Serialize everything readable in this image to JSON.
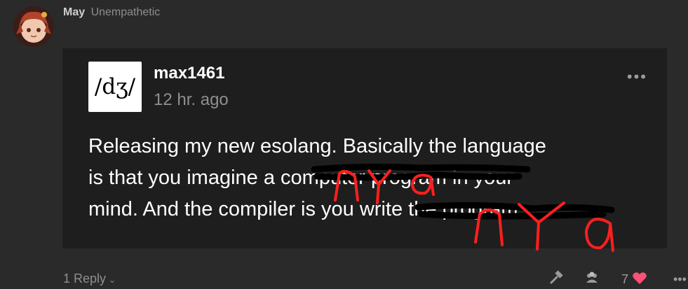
{
  "comment": {
    "author": "May",
    "tag": "Unempathetic"
  },
  "post": {
    "logo_text": "/dʒ/",
    "username": "max1461",
    "time": "12 hr. ago",
    "more_label": "•••",
    "lines": [
      "Releasing my new esolang. Basically the language",
      "is that you imagine a computer program in your",
      "mind. And the compiler is you write the program."
    ],
    "scribble_text": [
      "nya",
      "nya"
    ]
  },
  "footer": {
    "replies_label": "1 Reply",
    "replies_chevron": "⌄",
    "like_count": "7",
    "more_label": "•••"
  },
  "colors": {
    "scribble_red": "#ff1f1f",
    "heart": "#ff4f7b"
  }
}
